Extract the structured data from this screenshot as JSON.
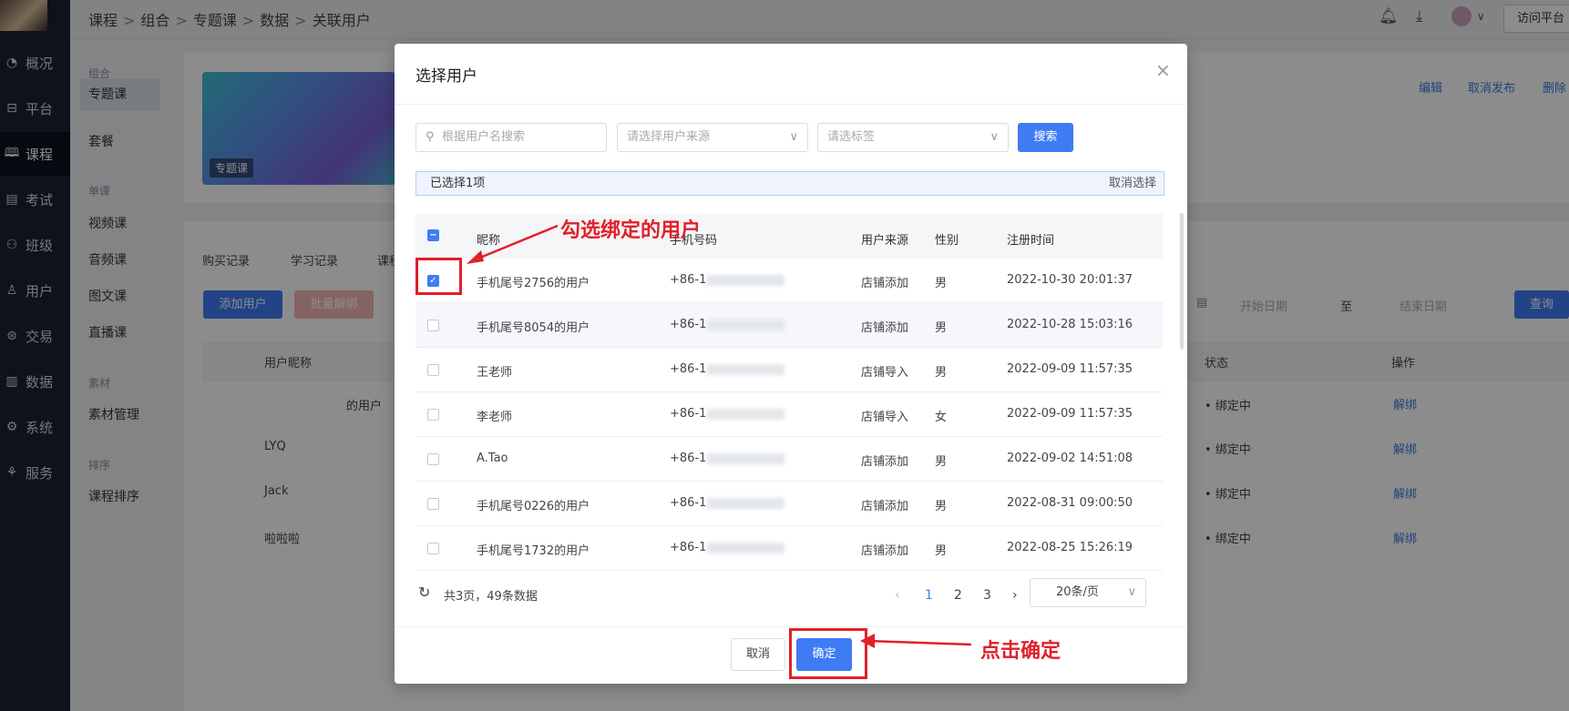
{
  "breadcrumb": [
    "课程",
    "组合",
    "专题课",
    "数据",
    "关联用户"
  ],
  "topbar": {
    "visit_label": "访问平台"
  },
  "nav": [
    {
      "icon": "pie-chart-icon",
      "label": "概况"
    },
    {
      "icon": "platform-icon",
      "label": "平台"
    },
    {
      "icon": "book-icon",
      "label": "课程"
    },
    {
      "icon": "exam-icon",
      "label": "考试"
    },
    {
      "icon": "class-icon",
      "label": "班级"
    },
    {
      "icon": "user-icon",
      "label": "用户"
    },
    {
      "icon": "trade-icon",
      "label": "交易"
    },
    {
      "icon": "bar-chart-icon",
      "label": "数据"
    },
    {
      "icon": "gear-icon",
      "label": "系统"
    },
    {
      "icon": "service-icon",
      "label": "服务"
    }
  ],
  "subnav": {
    "group1": "组合",
    "item_topic": "专题课",
    "item_package": "套餐",
    "group2": "单课",
    "item_video": "视频课",
    "item_audio": "音频课",
    "item_article": "图文课",
    "item_live": "直播课",
    "group3": "素材",
    "item_material": "素材管理",
    "group4": "排序",
    "item_sort": "课程排序"
  },
  "banner_tag": "专题课",
  "header_actions": [
    "编辑",
    "取消发布",
    "删除"
  ],
  "bg_tabs": [
    "购买记录",
    "学习记录",
    "课程"
  ],
  "bg_buttons": {
    "add": "添加用户",
    "batch_unbind": "批量解绑",
    "query": "查询"
  },
  "bg_dates": {
    "start": "开始日期",
    "to": "至",
    "end": "结束日期"
  },
  "bg_table": {
    "headers": {
      "nickname": "用户昵称",
      "status": "状态",
      "action": "操作"
    },
    "rows": [
      {
        "name": "的用户",
        "status": "绑定中",
        "action": "解绑"
      },
      {
        "name": "LYQ",
        "status": "绑定中",
        "action": "解绑"
      },
      {
        "name": "Jack",
        "status": "绑定中",
        "action": "解绑"
      },
      {
        "name": "啦啦啦",
        "status": "绑定中",
        "action": "解绑"
      }
    ]
  },
  "modal": {
    "title": "选择用户",
    "search_placeholder": "根据用户名搜索",
    "source_placeholder": "请选择用户来源",
    "tag_placeholder": "请选标签",
    "search_button": "搜索",
    "selected_text": "已选择1项",
    "cancel_selection": "取消选择",
    "columns": {
      "nickname": "昵称",
      "phone": "手机号码",
      "source": "用户来源",
      "gender": "性别",
      "reg_time": "注册时间"
    },
    "rows": [
      {
        "checked": true,
        "nickname": "手机尾号2756的用户",
        "phone": "+86-1",
        "source": "店铺添加",
        "gender": "男",
        "reg_time": "2022-10-30 20:01:37"
      },
      {
        "checked": false,
        "nickname": "手机尾号8054的用户",
        "phone": "+86-1",
        "source": "店铺添加",
        "gender": "男",
        "reg_time": "2022-10-28 15:03:16"
      },
      {
        "checked": false,
        "nickname": "王老师",
        "phone": "+86-1",
        "source": "店铺导入",
        "gender": "男",
        "reg_time": "2022-09-09 11:57:35"
      },
      {
        "checked": false,
        "nickname": "李老师",
        "phone": "+86-1",
        "source": "店铺导入",
        "gender": "女",
        "reg_time": "2022-09-09 11:57:35"
      },
      {
        "checked": false,
        "nickname": "A.Tao",
        "phone": "+86-1",
        "source": "店铺添加",
        "gender": "男",
        "reg_time": "2022-09-02 14:51:08"
      },
      {
        "checked": false,
        "nickname": "手机尾号0226的用户",
        "phone": "+86-1",
        "source": "店铺添加",
        "gender": "男",
        "reg_time": "2022-08-31 09:00:50"
      },
      {
        "checked": false,
        "nickname": "手机尾号1732的用户",
        "phone": "+86-1",
        "source": "店铺添加",
        "gender": "男",
        "reg_time": "2022-08-25 15:26:19"
      }
    ],
    "summary": "共3页，49条数据",
    "pages": [
      "1",
      "2",
      "3"
    ],
    "page_size": "20条/页",
    "cancel_button": "取消",
    "confirm_button": "确定"
  },
  "annotations": {
    "select_hint": "勾选绑定的用户",
    "confirm_hint": "点击确定",
    "color": "#e0202a"
  },
  "colors": {
    "primary": "#3f7cf4",
    "nav_bg": "#1b2231"
  }
}
